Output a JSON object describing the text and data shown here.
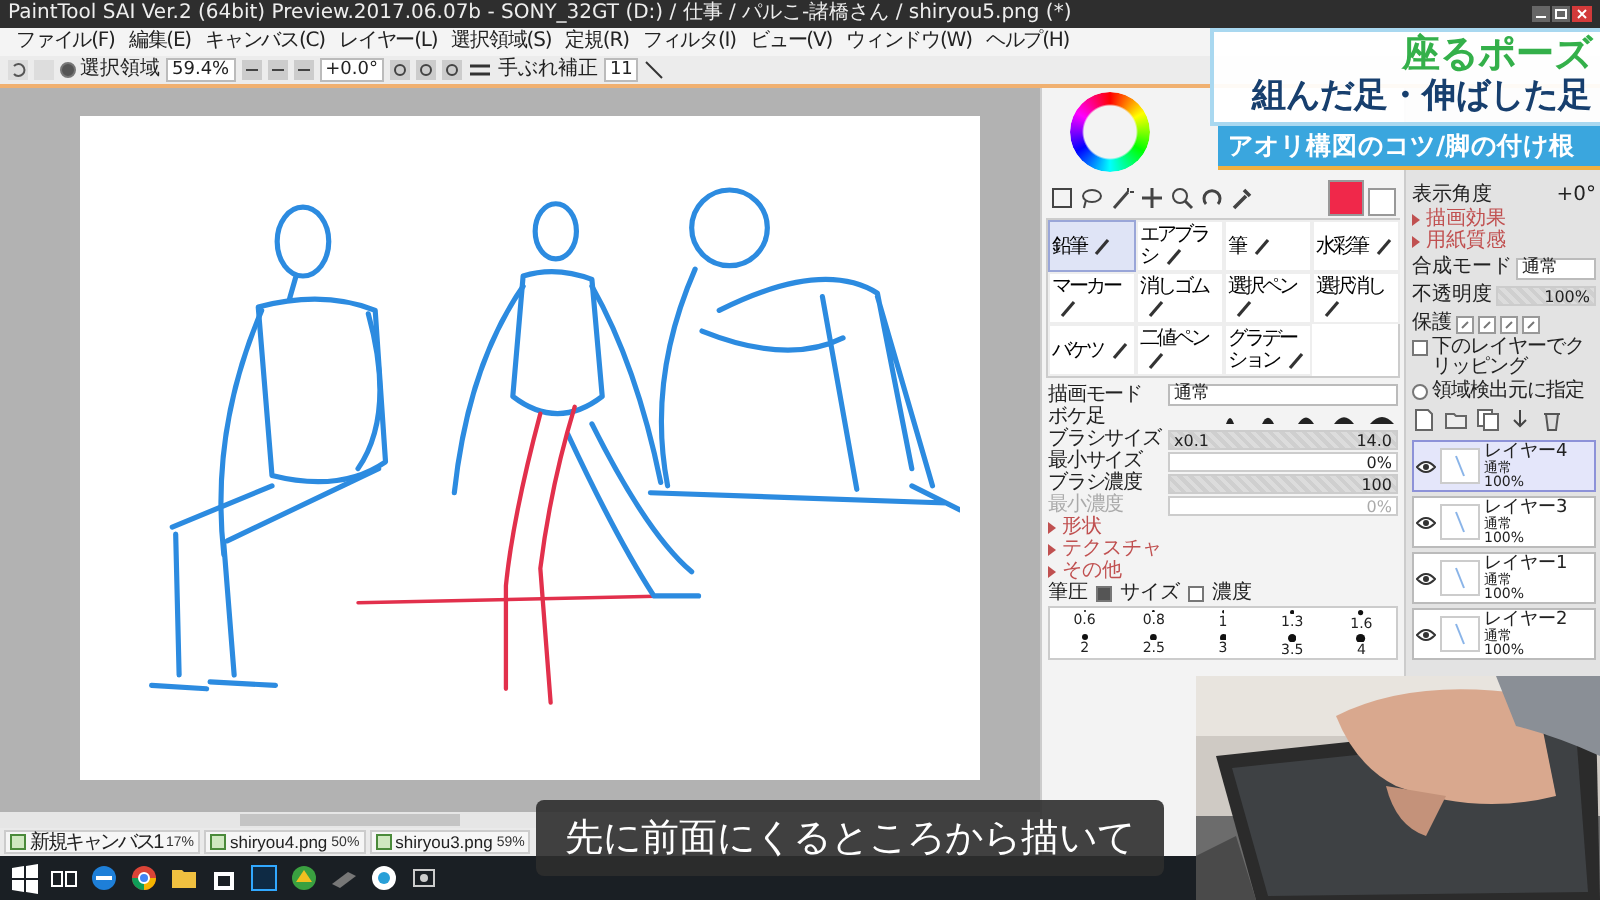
{
  "window": {
    "title": "PaintTool SAI Ver.2 (64bit) Preview.2017.06.07b - SONY_32GT (D:) / 仕事 / パルこ-諸橋さん / shiryou5.png (*)"
  },
  "menu": [
    "ファイル(F)",
    "編集(E)",
    "キャンバス(C)",
    "レイヤー(L)",
    "選択領域(S)",
    "定規(R)",
    "フィルタ(I)",
    "ビュー(V)",
    "ウィンドウ(W)",
    "ヘルプ(H)"
  ],
  "toolbar": {
    "selection": {
      "label": "選択領域",
      "checked": true
    },
    "zoom": "59.4%",
    "angle": "+0.0°",
    "stabilizer_label": "手ぶれ補正",
    "stabilizer": "11"
  },
  "tools": [
    {
      "label": "鉛筆",
      "selected": true
    },
    {
      "label": "エアブラシ",
      "selected": false
    },
    {
      "label": "筆",
      "selected": false
    },
    {
      "label": "水彩筆",
      "selected": false
    },
    {
      "label": "マーカー",
      "selected": false
    },
    {
      "label": "消しゴム",
      "selected": false
    },
    {
      "label": "選択ペン",
      "selected": false
    },
    {
      "label": "選択消し",
      "selected": false
    },
    {
      "label": "バケツ",
      "selected": false
    },
    {
      "label": "二値ペン",
      "selected": false
    },
    {
      "label": "グラデーション",
      "selected": false
    }
  ],
  "brush": [
    {
      "kind": "select",
      "label": "描画モード",
      "value": "通常",
      "disabled": false
    },
    {
      "kind": "shapes",
      "label": "ボケ足",
      "disabled": false
    },
    {
      "kind": "slider",
      "label": "ブラシサイズ",
      "prefix": "x0.1",
      "value": "14.0",
      "level": 1,
      "disabled": false
    },
    {
      "kind": "slider",
      "label": "最小サイズ",
      "value": "0%",
      "level": 0,
      "disabled": false
    },
    {
      "kind": "slider",
      "label": "ブラシ濃度",
      "value": "100",
      "level": 1,
      "disabled": false
    },
    {
      "kind": "slider",
      "label": "最小濃度",
      "value": "0%",
      "level": 0,
      "disabled": true
    }
  ],
  "brush_sections": [
    {
      "label": "形状",
      "expanded": false
    },
    {
      "label": "テクスチャ",
      "expanded": false
    },
    {
      "label": "その他",
      "expanded": false
    }
  ],
  "pressure": {
    "label": "筆圧",
    "options": [
      {
        "label": "サイズ",
        "checked": true
      },
      {
        "label": "濃度",
        "checked": false
      }
    ]
  },
  "brush_sizes": [
    "0.6",
    "0.8",
    "1",
    "1.3",
    "1.6",
    "2",
    "2.5",
    "3",
    "3.5",
    "4"
  ],
  "view_angle": {
    "label": "表示角度",
    "value": "+0°"
  },
  "effect_sections": [
    {
      "label": "描画効果",
      "expanded": false
    },
    {
      "label": "用紙質感",
      "expanded": false
    }
  ],
  "layer_settings": {
    "blend_label": "合成モード",
    "blend": "通常",
    "opacity_label": "不透明度",
    "opacity": "100%",
    "level": 1,
    "protect_label": "保護"
  },
  "layer_options": [
    {
      "kind": "checkbox",
      "label": "下のレイヤーでクリッピング",
      "checked": false
    },
    {
      "kind": "radio",
      "label": "領域検出元に指定",
      "checked": false
    }
  ],
  "layers": [
    {
      "name": "レイヤー4",
      "mode": "通常",
      "opacity": "100%",
      "selected": true,
      "visible": true
    },
    {
      "name": "レイヤー3",
      "mode": "通常",
      "opacity": "100%",
      "selected": false,
      "visible": true
    },
    {
      "name": "レイヤー1",
      "mode": "通常",
      "opacity": "100%",
      "selected": false,
      "visible": true
    },
    {
      "name": "レイヤー2",
      "mode": "通常",
      "opacity": "100%",
      "selected": false,
      "visible": true
    }
  ],
  "documents": [
    {
      "name": "新規キャンバス1",
      "zoom": "17%",
      "selected": false
    },
    {
      "name": "shiryou4.png",
      "zoom": "50%",
      "selected": false
    },
    {
      "name": "shiryou3.png",
      "zoom": "59%",
      "selected": false
    }
  ],
  "overlay": {
    "title": "座るポーズ",
    "subtitle": "組んだ足・伸ばした足",
    "banner": "アオリ構図のコツ/脚の付け根"
  },
  "caption": "先に前面にくるところから描いて"
}
